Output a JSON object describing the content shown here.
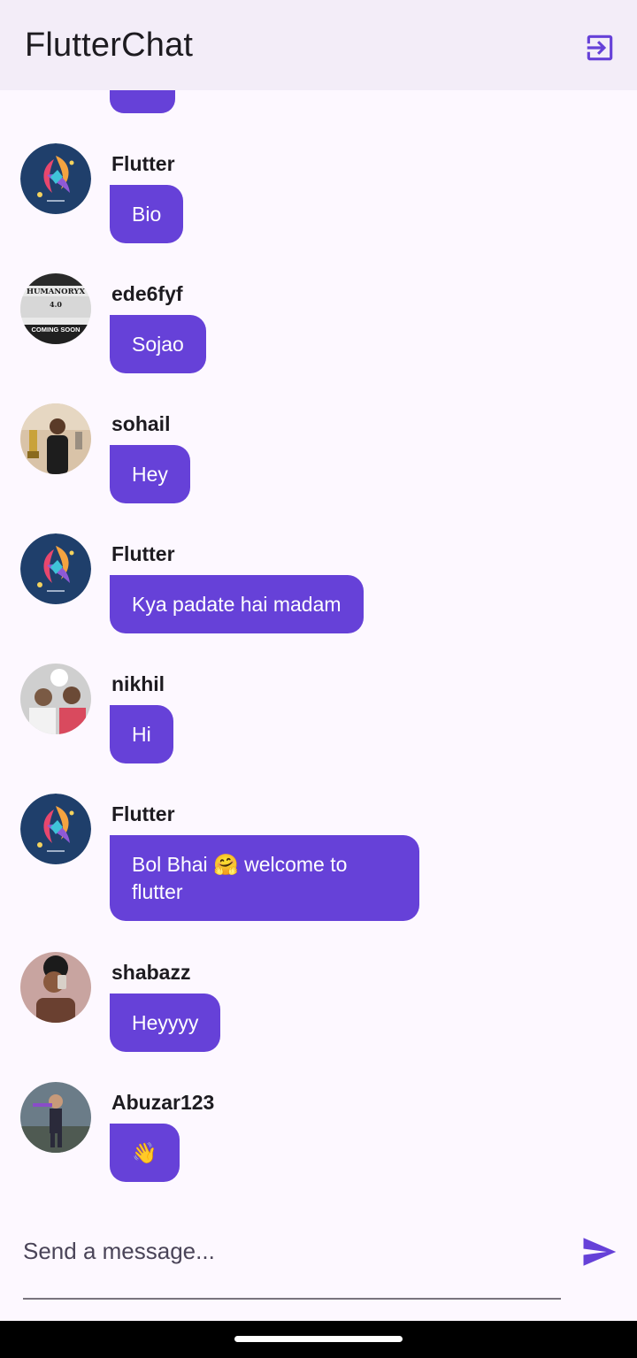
{
  "app_bar": {
    "title": "FlutterChat",
    "logout_icon": "logout-icon",
    "background": "#f3edf8",
    "icon_color": "#6641d8"
  },
  "theme": {
    "bubble_color": "#6641d8",
    "bubble_text": "#ffffff",
    "page_background": "#fdf8ff"
  },
  "messages": [
    {
      "sender": "Flutter",
      "text": "Bio",
      "avatar": "flutter-logo-avatar"
    },
    {
      "sender": "ede6fyf",
      "text": "Sojao",
      "avatar": "poster-avatar",
      "avatar_text": {
        "line1": "HUMANORYX",
        "line2": "4.0",
        "line3": "COMING SOON"
      }
    },
    {
      "sender": "sohail",
      "text": "Hey",
      "avatar": "person-photo-avatar"
    },
    {
      "sender": "Flutter",
      "text": "Kya padate hai madam",
      "avatar": "flutter-logo-avatar"
    },
    {
      "sender": "nikhil",
      "text": "Hi",
      "avatar": "group-photo-avatar"
    },
    {
      "sender": "Flutter",
      "text": "Bol Bhai 🤗 welcome to flutter",
      "avatar": "flutter-logo-avatar"
    },
    {
      "sender": "shabazz",
      "text": "Heyyyy",
      "avatar": "selfie-photo-avatar"
    },
    {
      "sender": "Abuzar123",
      "text": "👋",
      "avatar": "game-character-avatar"
    }
  ],
  "composer": {
    "placeholder": "Send a message...",
    "send_icon": "send-icon"
  }
}
